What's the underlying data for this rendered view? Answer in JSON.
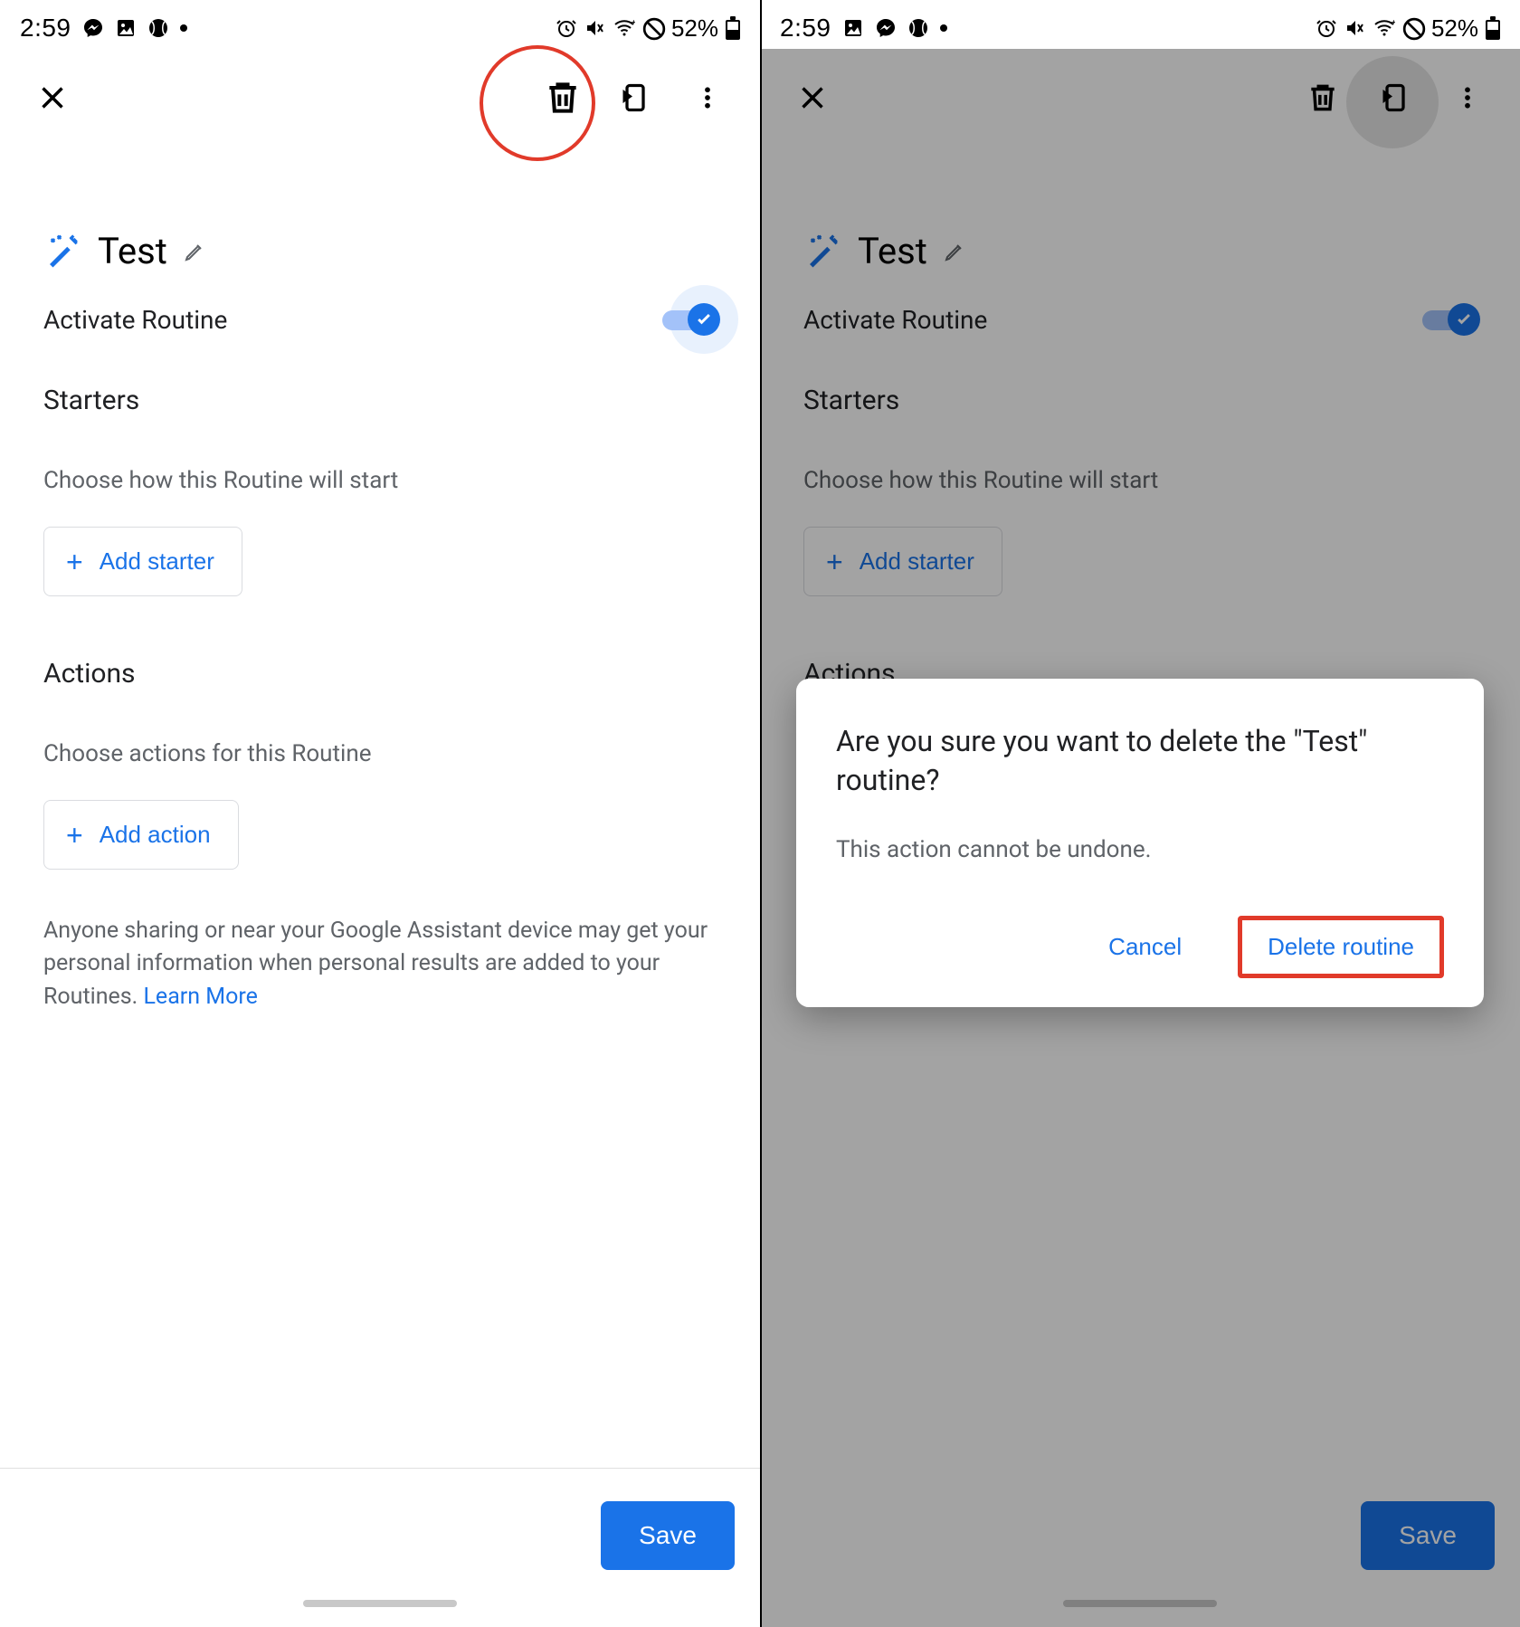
{
  "status": {
    "time": "2:59",
    "battery": "52%"
  },
  "routine": {
    "name": "Test",
    "activate_label": "Activate Routine",
    "starters_heading": "Starters",
    "starters_sub": "Choose how this Routine will start",
    "add_starter": "Add starter",
    "actions_heading": "Actions",
    "actions_sub": "Choose actions for this Routine",
    "add_action": "Add action",
    "disclaimer": "Anyone sharing or near your Google Assistant device may get your personal information when personal results are added to your Routines. ",
    "learn_more": "Learn More",
    "save": "Save"
  },
  "dialog": {
    "title": "Are you sure you want to delete the \"Test\" routine?",
    "body": "This action cannot be undone.",
    "cancel": "Cancel",
    "confirm": "Delete routine"
  }
}
